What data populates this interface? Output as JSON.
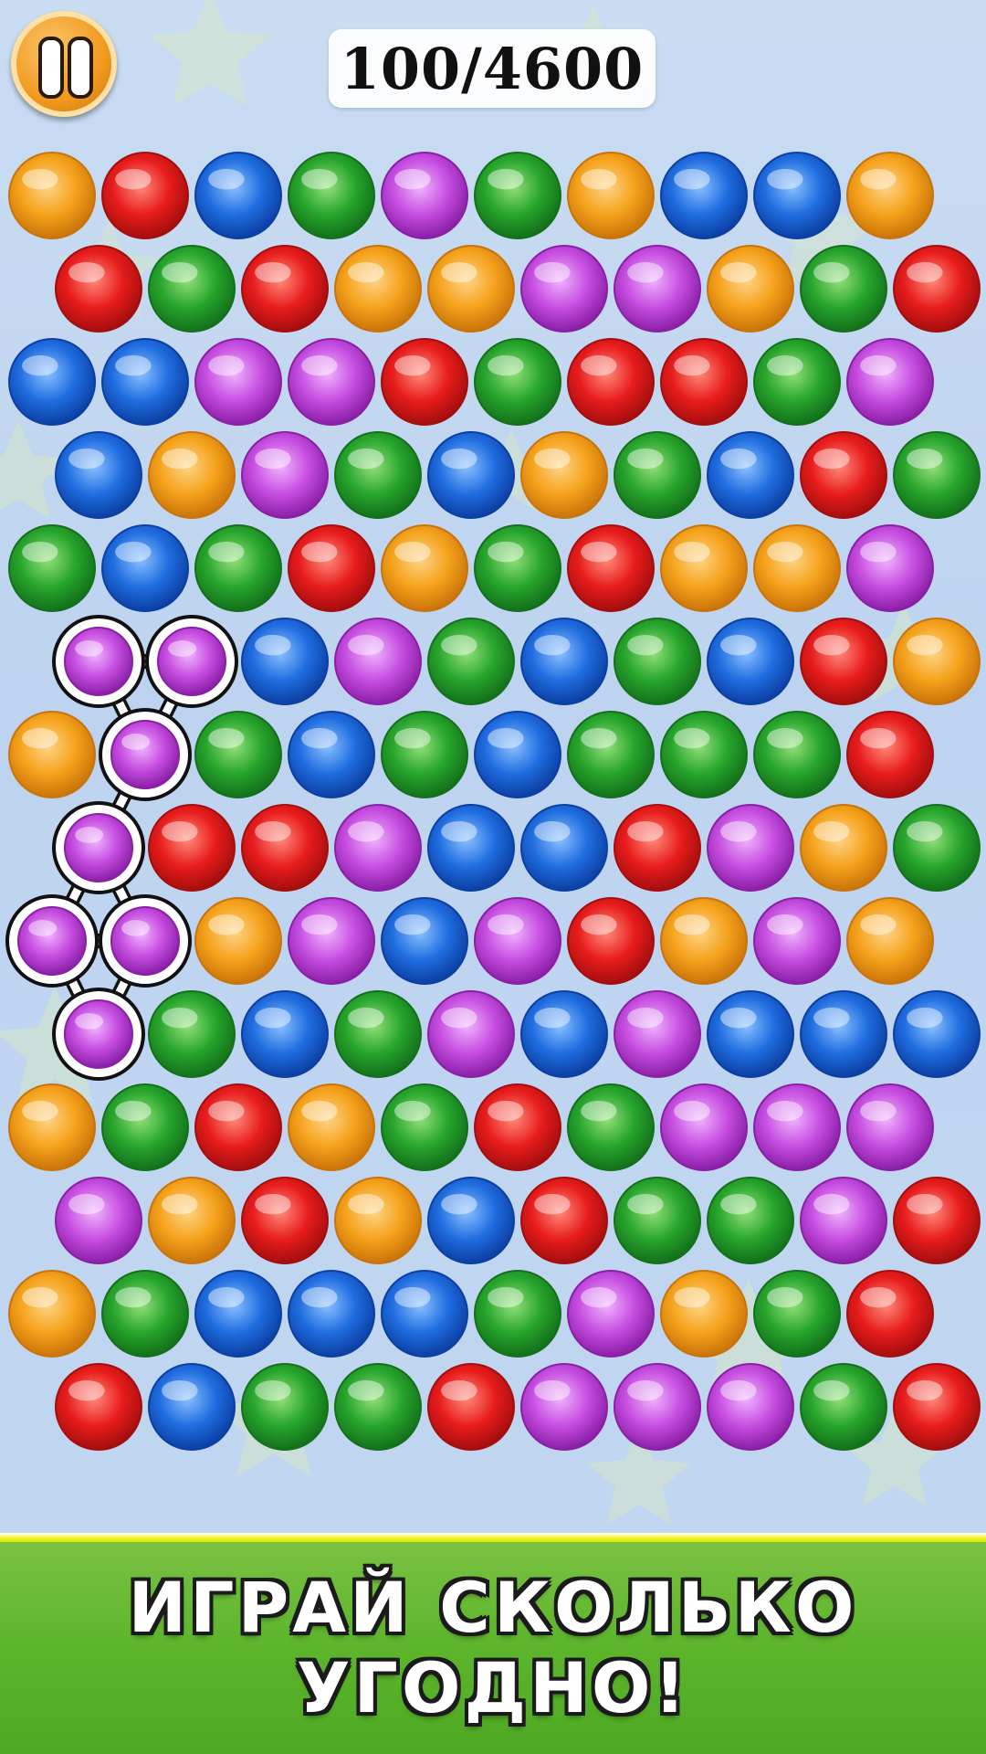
{
  "hud": {
    "score": "100/4600",
    "pause_icon": "pause-icon"
  },
  "promo": {
    "line1": "ИГРАЙ СКОЛЬКО",
    "line2": "УГОДНО!"
  },
  "colors": {
    "orange": "#f5a21b",
    "red": "#e81c1c",
    "blue": "#1f6de0",
    "green": "#27a52c",
    "purple": "#c64de0",
    "background": "#c2d7f1",
    "footer_green": "#5cb52b",
    "stripe_yellow": "#f2f21a"
  },
  "board": {
    "rows": [
      [
        "O",
        "R",
        "B",
        "G",
        "P",
        "G",
        "O",
        "B",
        "B",
        "O"
      ],
      [
        "R",
        "G",
        "R",
        "O",
        "O",
        "P",
        "P",
        "O",
        "G",
        "R"
      ],
      [
        "B",
        "B",
        "P",
        "P",
        "R",
        "G",
        "R",
        "R",
        "G",
        "P"
      ],
      [
        "B",
        "O",
        "P",
        "G",
        "B",
        "O",
        "G",
        "B",
        "R",
        "G"
      ],
      [
        "G",
        "B",
        "G",
        "R",
        "O",
        "G",
        "R",
        "O",
        "O",
        "P"
      ],
      [
        "P",
        "P",
        "B",
        "P",
        "G",
        "B",
        "G",
        "B",
        "R",
        "O"
      ],
      [
        "O",
        "P",
        "G",
        "B",
        "G",
        "B",
        "G",
        "G",
        "G",
        "R"
      ],
      [
        "P",
        "R",
        "R",
        "P",
        "B",
        "B",
        "R",
        "P",
        "O",
        "G"
      ],
      [
        "P",
        "P",
        "O",
        "P",
        "B",
        "P",
        "R",
        "O",
        "P",
        "O"
      ],
      [
        "P",
        "G",
        "B",
        "G",
        "P",
        "B",
        "P",
        "B",
        "B",
        "B"
      ],
      [
        "O",
        "G",
        "R",
        "O",
        "G",
        "R",
        "G",
        "P",
        "P",
        "P"
      ],
      [
        "P",
        "O",
        "R",
        "O",
        "B",
        "R",
        "G",
        "G",
        "P",
        "R"
      ],
      [
        "O",
        "G",
        "B",
        "B",
        "B",
        "G",
        "P",
        "O",
        "G",
        "R"
      ],
      [
        "R",
        "B",
        "G",
        "G",
        "R",
        "P",
        "P",
        "P",
        "G",
        "R"
      ]
    ],
    "selected_chain": [
      [
        5,
        0
      ],
      [
        5,
        1
      ],
      [
        6,
        1
      ],
      [
        7,
        0
      ],
      [
        8,
        0
      ],
      [
        8,
        1
      ],
      [
        9,
        0
      ]
    ]
  }
}
